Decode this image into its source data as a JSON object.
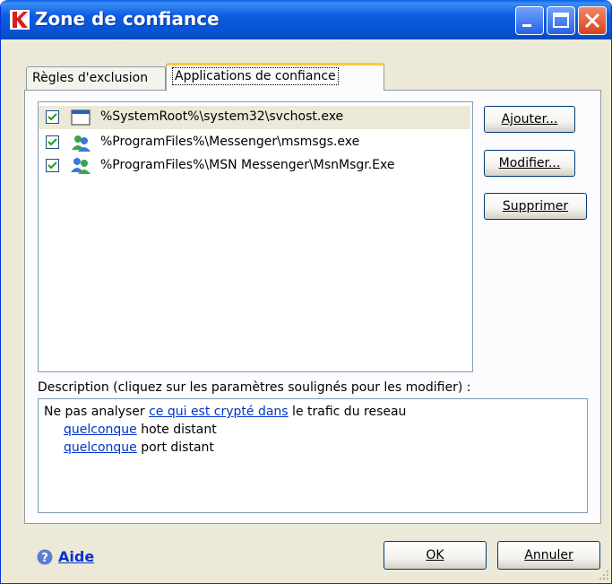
{
  "window": {
    "title": "Zone de confiance"
  },
  "tabs": [
    {
      "label": "Règles d'exclusion",
      "active": false
    },
    {
      "label": "Applications de confiance",
      "active": true
    }
  ],
  "applications": [
    {
      "path": "%SystemRoot%\\system32\\svchost.exe",
      "checked": true,
      "icon": "window-app-icon",
      "selected": true
    },
    {
      "path": "%ProgramFiles%\\Messenger\\msmsgs.exe",
      "checked": true,
      "icon": "messenger-users-icon",
      "selected": false
    },
    {
      "path": "%ProgramFiles%\\MSN Messenger\\MsnMsgr.Exe",
      "checked": true,
      "icon": "msn-users-icon",
      "selected": false
    }
  ],
  "buttons": {
    "add": "Ajouter...",
    "modify": "Modifier...",
    "delete": "Supprimer",
    "ok": "OK",
    "cancel": "Annuler"
  },
  "description": {
    "label": "Description (cliquez sur les paramètres soulignés pour les modifier) :",
    "line1_prefix": "Ne pas analyser ",
    "line1_link": "ce qui est crypté dans",
    "line1_suffix": " le trafic du reseau",
    "line2_link": "quelconque",
    "line2_suffix": " hote distant",
    "line3_link": "quelconque",
    "line3_suffix": " port distant"
  },
  "help": {
    "label": "Aide"
  },
  "colors": {
    "title_bar": "#0554d6",
    "link": "#0033cc",
    "active_tab_accent": "#ffc83c",
    "kaspersky_logo": "#d81e1e"
  }
}
